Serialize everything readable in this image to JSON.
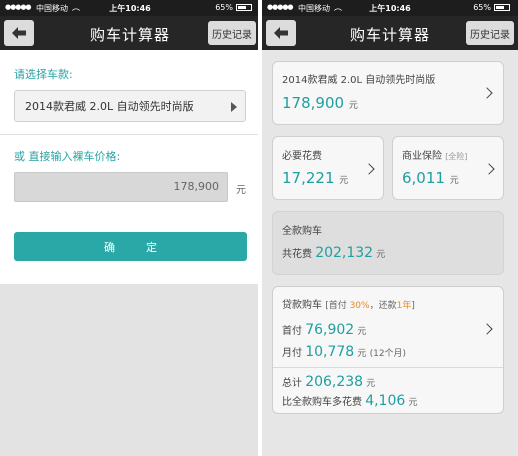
{
  "status": {
    "signal": "●●●●●",
    "carrier": "中国移动",
    "time": "上午10:46",
    "battery": "65%"
  },
  "nav": {
    "title": "购车计算器",
    "history": "历史记录"
  },
  "left": {
    "choose_label": "请选择车款:",
    "selected_model": "2014款君威 2.0L 自动领先时尚版",
    "input_label": "或 直接输入裸车价格:",
    "price_value": "178,900",
    "unit": "元",
    "confirm": "确　定"
  },
  "right": {
    "model": {
      "name": "2014款君威 2.0L 自动领先时尚版",
      "price": "178,900",
      "unit": "元"
    },
    "necessary": {
      "label": "必要花费",
      "value": "17,221",
      "unit": "元"
    },
    "insurance": {
      "label": "商业保险",
      "tag": "[全险]",
      "value": "6,011",
      "unit": "元"
    },
    "full": {
      "label": "全款购车",
      "total_label": "共花费",
      "total": "202,132",
      "unit": "元"
    },
    "loan": {
      "label": "贷款购车",
      "bracket_open": "[首付 ",
      "down_ratio": "30%",
      "mid": "，还款",
      "years": "1年",
      "bracket_close": "]",
      "down_label": "首付",
      "down_value": "76,902",
      "monthly_label": "月付",
      "monthly_value": "10,778",
      "monthly_note": "(12个月)",
      "unit": "元",
      "sum_label": "总计",
      "sum_value": "206,238",
      "extra_label": "比全款购车多花费",
      "extra_value": "4,106"
    }
  }
}
